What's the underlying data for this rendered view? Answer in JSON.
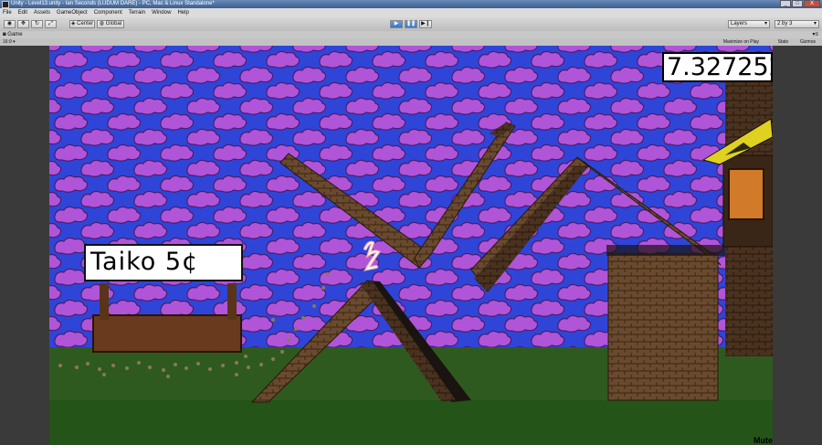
{
  "window": {
    "title": "Unity - Level13.unity - Ian Seconds (LUDUM DARE) - PC, Mac & Linux Standalone*",
    "controls": [
      "_",
      "□",
      "X"
    ]
  },
  "menu": [
    "File",
    "Edit",
    "Assets",
    "GameObject",
    "Component",
    "Terrain",
    "Window",
    "Help"
  ],
  "toolbar": {
    "pivot": "Center",
    "space": "Global",
    "layers": "Layers",
    "layout": "2 by 3"
  },
  "game_panel": {
    "tab": "Game",
    "aspect": "16:9",
    "maximize_on_play": "Maximize on Play",
    "stats": "Stats",
    "gizmos": "Gizmos"
  },
  "game": {
    "timer": "7.327252",
    "sign": "Taiko 5¢",
    "mute": "Mute"
  },
  "colors": {
    "sky": "#2f45d8",
    "cloud": "#b055d8",
    "grass": "#2f5a1f",
    "wood": "#6a4a2e",
    "accent": "#3d74c2"
  }
}
